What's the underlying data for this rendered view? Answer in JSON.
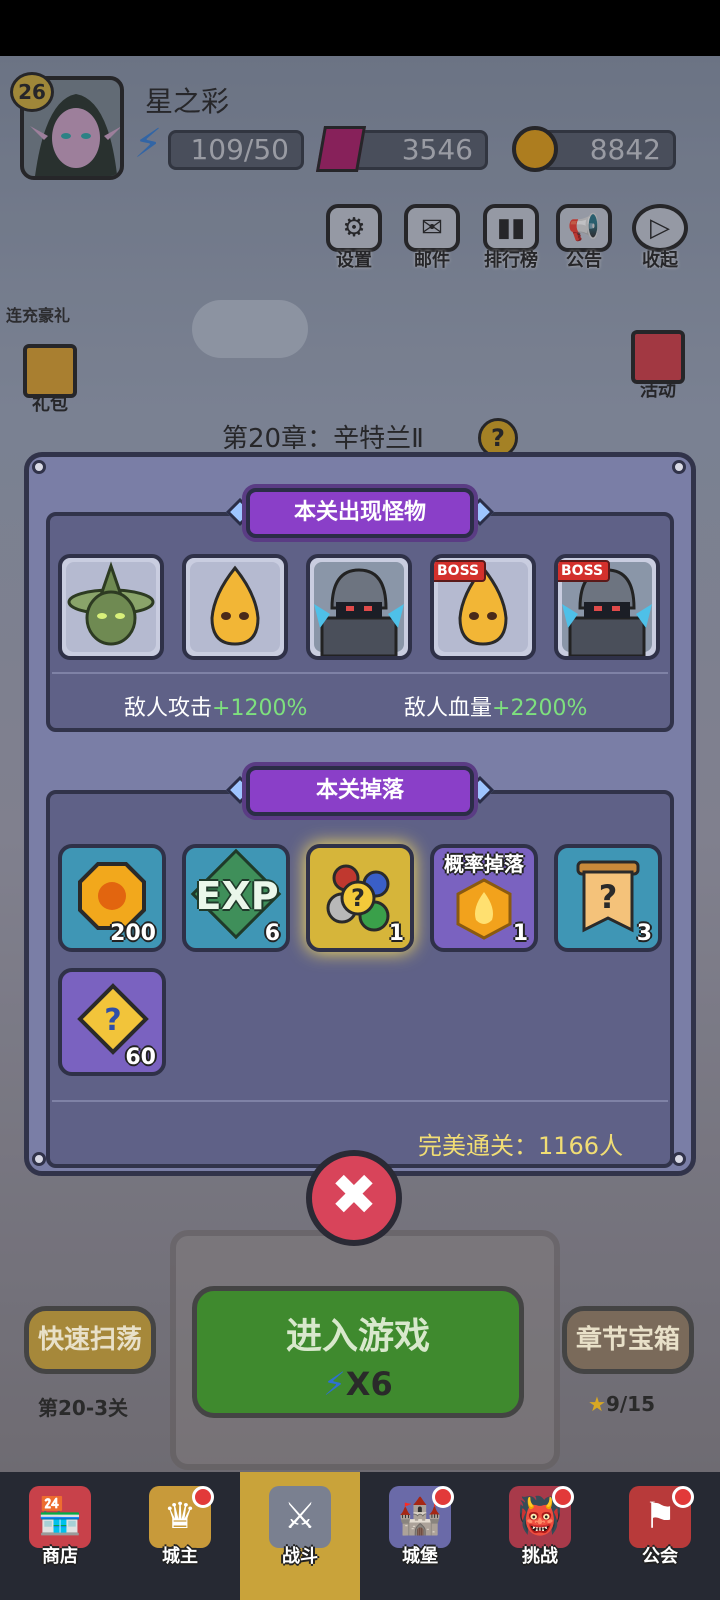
{
  "player": {
    "level": "26",
    "name": "星之彩"
  },
  "resources": {
    "energy": "109/50",
    "gems": "3546",
    "gold": "8842"
  },
  "top_buttons": [
    "设置",
    "邮件",
    "排行榜",
    "公告",
    "收起"
  ],
  "side_left": {
    "promo_title": "连充豪礼",
    "gift_label": "礼包"
  },
  "side_right": {
    "activity_label": "活动"
  },
  "chapter": {
    "title": "第20章：辛特兰Ⅱ"
  },
  "monsters_section": {
    "title": "本关出现怪物",
    "monsters": [
      {
        "name": "green-slime-monster",
        "boss": false
      },
      {
        "name": "fire-spirit-monster",
        "boss": false
      },
      {
        "name": "armored-knight-monster",
        "boss": false
      },
      {
        "name": "fire-spirit-monster",
        "boss": true
      },
      {
        "name": "armored-knight-monster",
        "boss": true
      }
    ],
    "boss_tag": "BOSS",
    "attack_label": "敌人攻击",
    "attack_value": "+1200%",
    "hp_label": "敌人血量",
    "hp_value": "+2200%"
  },
  "drops_section": {
    "title": "本关掉落",
    "chance_label": "概率掉落",
    "items": [
      {
        "icon": "gold-coin-icon",
        "count": "200"
      },
      {
        "icon": "exp-icon",
        "count": "6",
        "text": "EXP"
      },
      {
        "icon": "gem-bundle-icon",
        "count": "1"
      },
      {
        "icon": "golden-fire-token-icon",
        "count": "1"
      },
      {
        "icon": "mystery-scroll-icon",
        "count": "3"
      },
      {
        "icon": "mystery-puzzle-icon",
        "count": "60"
      }
    ],
    "perfect_clear": "完美通关：1166人"
  },
  "bottom": {
    "sweep_label": "快速扫荡",
    "sweep_stage": "第20-3关",
    "enter_label": "进入游戏",
    "enter_cost": "X6",
    "chest_label": "章节宝箱",
    "chest_progress": "9/15"
  },
  "nav": [
    "商店",
    "城主",
    "战斗",
    "城堡",
    "挑战",
    "公会"
  ],
  "colors": {
    "accent_purple": "#8a3fc8",
    "positive_green": "#7ee07e",
    "close_red": "#d8445a",
    "enter_green": "#3f8a2e"
  }
}
